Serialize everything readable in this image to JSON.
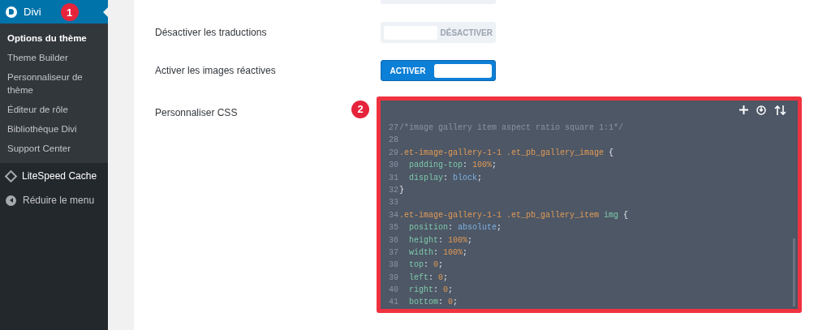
{
  "sidebar": {
    "header": {
      "label": "Divi",
      "badge": "1",
      "selected": true
    },
    "submenu": [
      {
        "label": "Options du thème",
        "selected": true
      },
      {
        "label": "Theme Builder",
        "selected": false
      },
      {
        "label": "Personnaliseur de thème",
        "selected": false
      },
      {
        "label": "Éditeur de rôle",
        "selected": false
      },
      {
        "label": "Bibliothèque Divi",
        "selected": false
      },
      {
        "label": "Support Center",
        "selected": false
      }
    ],
    "items": [
      {
        "label": "LiteSpeed Cache",
        "kind": "plugin"
      },
      {
        "label": "Réduire le menu",
        "kind": "collapse"
      }
    ]
  },
  "partial_toggle": {
    "on": false
  },
  "settings": [
    {
      "label": "Désactiver les traductions",
      "on": false,
      "text": "DÉSACTIVER"
    },
    {
      "label": "Activer les images réactives",
      "on": true,
      "text": "ACTIVER"
    }
  ],
  "css_editor": {
    "label": "Personnaliser CSS",
    "badge": "2",
    "lines": [
      {
        "number": "27",
        "tokens": [
          {
            "kind": "comment",
            "text": "/*image gallery item aspect ratio square 1:1*/"
          }
        ]
      },
      {
        "number": "28"
      },
      {
        "number": "29",
        "tokens": [
          {
            "kind": "selector",
            "text": ".et-image-gallery-1-1 .et_pb_gallery_image"
          },
          {
            "kind": "punct",
            "text": " {"
          }
        ]
      },
      {
        "number": "30",
        "tokens": [
          {
            "kind": "property",
            "text": "  padding-top"
          },
          {
            "kind": "punct",
            "text": ": "
          },
          {
            "kind": "number",
            "text": "100%"
          },
          {
            "kind": "punct",
            "text": ";"
          }
        ]
      },
      {
        "number": "31",
        "tokens": [
          {
            "kind": "property",
            "text": "  display"
          },
          {
            "kind": "punct",
            "text": ": "
          },
          {
            "kind": "keyword",
            "text": "block"
          },
          {
            "kind": "punct",
            "text": ";"
          }
        ]
      },
      {
        "number": "32",
        "tokens": [
          {
            "kind": "punct",
            "text": "}"
          }
        ]
      },
      {
        "number": "33"
      },
      {
        "number": "34",
        "tokens": [
          {
            "kind": "selector",
            "text": ".et-image-gallery-1-1 .et_pb_gallery_item"
          },
          {
            "kind": "property",
            "text": " img"
          },
          {
            "kind": "punct",
            "text": " {"
          }
        ]
      },
      {
        "number": "35",
        "tokens": [
          {
            "kind": "property",
            "text": "  position"
          },
          {
            "kind": "punct",
            "text": ": "
          },
          {
            "kind": "keyword",
            "text": "absolute"
          },
          {
            "kind": "punct",
            "text": ";"
          }
        ]
      },
      {
        "number": "36",
        "tokens": [
          {
            "kind": "property",
            "text": "  height"
          },
          {
            "kind": "punct",
            "text": ": "
          },
          {
            "kind": "number",
            "text": "100%"
          },
          {
            "kind": "punct",
            "text": ";"
          }
        ]
      },
      {
        "number": "37",
        "tokens": [
          {
            "kind": "property",
            "text": "  width"
          },
          {
            "kind": "punct",
            "text": ": "
          },
          {
            "kind": "number",
            "text": "100%"
          },
          {
            "kind": "punct",
            "text": ";"
          }
        ]
      },
      {
        "number": "38",
        "tokens": [
          {
            "kind": "property",
            "text": "  top"
          },
          {
            "kind": "punct",
            "text": ": "
          },
          {
            "kind": "number",
            "text": "0"
          },
          {
            "kind": "punct",
            "text": ";"
          }
        ]
      },
      {
        "number": "39",
        "tokens": [
          {
            "kind": "property",
            "text": "  left"
          },
          {
            "kind": "punct",
            "text": ": "
          },
          {
            "kind": "number",
            "text": "0"
          },
          {
            "kind": "punct",
            "text": ";"
          }
        ]
      },
      {
        "number": "40",
        "tokens": [
          {
            "kind": "property",
            "text": "  right"
          },
          {
            "kind": "punct",
            "text": ": "
          },
          {
            "kind": "number",
            "text": "0"
          },
          {
            "kind": "punct",
            "text": ";"
          }
        ]
      },
      {
        "number": "41",
        "tokens": [
          {
            "kind": "property",
            "text": "  bottom"
          },
          {
            "kind": "punct",
            "text": ": "
          },
          {
            "kind": "number",
            "text": "0"
          },
          {
            "kind": "punct",
            "text": ";"
          }
        ]
      }
    ]
  }
}
